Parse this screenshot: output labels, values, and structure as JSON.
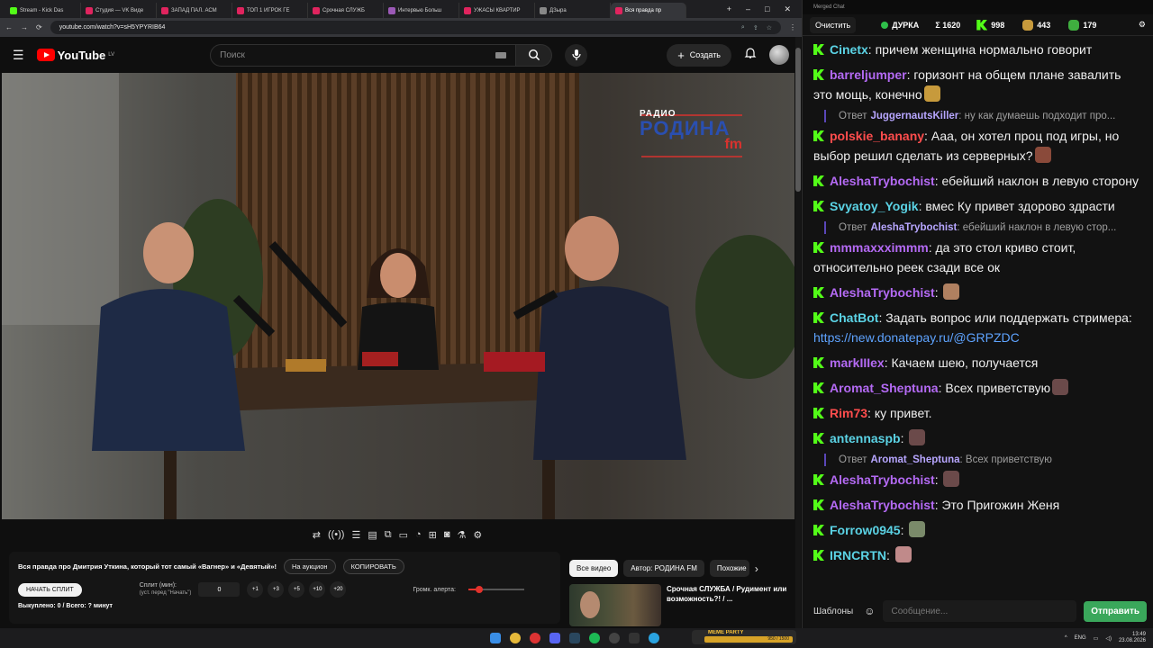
{
  "browser": {
    "tabs": [
      {
        "label": "Stream - Kick Das",
        "color": "#53fc18"
      },
      {
        "label": "Студия — VK Виде",
        "color": "#e0245e"
      },
      {
        "label": "ЗАПАД ПАЛ. АСМ",
        "color": "#e0245e"
      },
      {
        "label": "ТОП 1 ИГРОК ГЕ",
        "color": "#e0245e"
      },
      {
        "label": "Срочная СЛУЖБ",
        "color": "#e0245e"
      },
      {
        "label": "Интервью Больш",
        "color": "#9b59b6"
      },
      {
        "label": "УЖАСЫ КВАРТИР",
        "color": "#e0245e"
      },
      {
        "label": "ДЗыра",
        "color": "#888888"
      },
      {
        "label": "Вся правда пр",
        "color": "#e0245e",
        "active": true
      }
    ],
    "url": "youtube.com/watch?v=sH5YPYRIB64"
  },
  "youtube": {
    "region": "LV",
    "logo": "YouTube",
    "search_placeholder": "Поиск",
    "create_label": "Создать"
  },
  "video": {
    "brand_top": "РАДИО",
    "brand_main": "РОДИНА",
    "brand_sub": "fm"
  },
  "panel": {
    "title": "Вся правда про Дмитрия Уткина, который тот самый «Вагнер» и «Девятый»!",
    "auction_button": "На аукцион",
    "copy_button": "КОПИРОВАТЬ",
    "start_split": "НАЧАТЬ СПЛИТ",
    "split_label": "Сплит (мин):",
    "split_hint": "(уст. перед \"Начать\")",
    "split_value": "0",
    "increments": [
      "+1",
      "+3",
      "+5",
      "+10",
      "+20"
    ],
    "volume_label": "Громк. алерта:",
    "volume_level": 0.2,
    "bought": "Выкуплено: 0 / Всего: ? минут"
  },
  "related": {
    "chips": [
      "Все видео",
      "Автор: РОДИНА FM",
      "Похожие"
    ],
    "card_title": "Срочная СЛУЖБА / Рудимент или возможность?! / ..."
  },
  "chat": {
    "window_title": "Merged Chat",
    "clear_button": "Очистить",
    "channel": "ДУРКА",
    "sum": "Σ 1620",
    "kick_count": "998",
    "other_count": "443",
    "third_count": "179",
    "messages": [
      {
        "type": "msg",
        "user": "Cinetx",
        "color": "#5bd3e5",
        "text": "причем женщина нормально говорит"
      },
      {
        "type": "msg",
        "user": "barreljumper",
        "color": "#b46af4",
        "text": "горизонт на общем плане завалить это мощь, конечно",
        "emote": "#c79a3c"
      },
      {
        "type": "reply",
        "prefix": "Ответ",
        "user": "JuggernautsKiller",
        "text": ": ну как думаешь подходит про..."
      },
      {
        "type": "msg",
        "user": "polskie_banany",
        "color": "#ff4d4d",
        "text": "Ааа, он хотел проц под игры, но выбор решил сделать из серверных?",
        "emote": "#8a4a3a"
      },
      {
        "type": "msg",
        "user": "AleshaTrybochist",
        "color": "#b46af4",
        "text": "ебейший наклон в левую сторону"
      },
      {
        "type": "msg",
        "user": "Svyatoy_Yogik",
        "color": "#5bd3e5",
        "text": "вмес Ку привет здорово здрасти"
      },
      {
        "type": "reply",
        "prefix": "Ответ",
        "user": "AleshaTrybochist",
        "text": ": ебейший наклон в левую стор..."
      },
      {
        "type": "msg",
        "user": "mmmaxxximmm",
        "color": "#b46af4",
        "text": "да это стол криво стоит, относительно реек сзади все ок"
      },
      {
        "type": "msg",
        "user": "AleshaTrybochist",
        "color": "#b46af4",
        "text": "",
        "emote": "#b08060"
      },
      {
        "type": "msg",
        "user": "ChatBot",
        "color": "#5bd3e5",
        "text": "Задать вопрос или поддержать стримера: ",
        "link": "https://new.donatepay.ru/@GRPZDC"
      },
      {
        "type": "msg",
        "user": "markIIIex",
        "color": "#b46af4",
        "text": "Качаем шею, получается"
      },
      {
        "type": "msg",
        "user": "Aromat_Sheptuna",
        "color": "#b46af4",
        "text": "Всех приветствую",
        "emote": "#6b4a4a"
      },
      {
        "type": "msg",
        "user": "Rim73",
        "color": "#ff4d4d",
        "text": "ку привет."
      },
      {
        "type": "msg",
        "user": "antennaspb",
        "color": "#5bd3e5",
        "text": "",
        "emote": "#6b4a4a"
      },
      {
        "type": "reply",
        "prefix": "Ответ",
        "user": "Aromat_Sheptuna",
        "text": ": Всех приветствую"
      },
      {
        "type": "msg",
        "user": "AleshaTrybochist",
        "color": "#b46af4",
        "text": "",
        "emote": "#6b4a4a"
      },
      {
        "type": "msg",
        "user": "AleshaTrybochist",
        "color": "#b46af4",
        "text": "Это Пригожин Женя"
      },
      {
        "type": "msg",
        "user": "Forrow0945",
        "color": "#5bd3e5",
        "text": "",
        "emote": "#7a8a6a"
      },
      {
        "type": "msg",
        "user": "IRNCRTN",
        "color": "#5bd3e5",
        "text": "",
        "emote": "#c08a8a"
      }
    ],
    "templates_button": "Шаблоны",
    "input_placeholder": "Сообщение...",
    "send_button": "Отправить"
  },
  "taskbar": {
    "meme_label": "MEME PARTY",
    "meme_counter": "950 / 1500",
    "lang": "ENG",
    "time": "13:49",
    "date": "23.08.2026"
  }
}
